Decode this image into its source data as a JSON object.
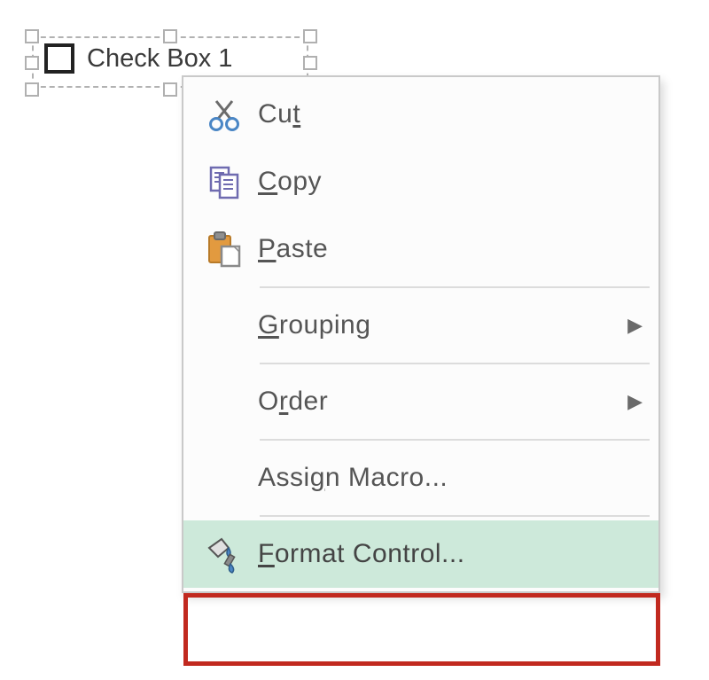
{
  "control": {
    "label": "Check Box 1"
  },
  "menu": {
    "cut": {
      "label_pre": "Cu",
      "label_ul": "t",
      "label_post": ""
    },
    "copy": {
      "label_pre": "",
      "label_ul": "C",
      "label_post": "opy"
    },
    "paste": {
      "label_pre": "",
      "label_ul": "P",
      "label_post": "aste"
    },
    "grouping": {
      "label_pre": "",
      "label_ul": "G",
      "label_post": "rouping"
    },
    "order": {
      "label_pre": "O",
      "label_ul": "r",
      "label_post": "der"
    },
    "assign_macro": {
      "label_pre": "Assi",
      "label_ul": "g",
      "label_post": "n Macro..."
    },
    "format_control": {
      "label_pre": "",
      "label_ul": "F",
      "label_post": "ormat Control..."
    }
  },
  "arrow_glyph": "▶"
}
